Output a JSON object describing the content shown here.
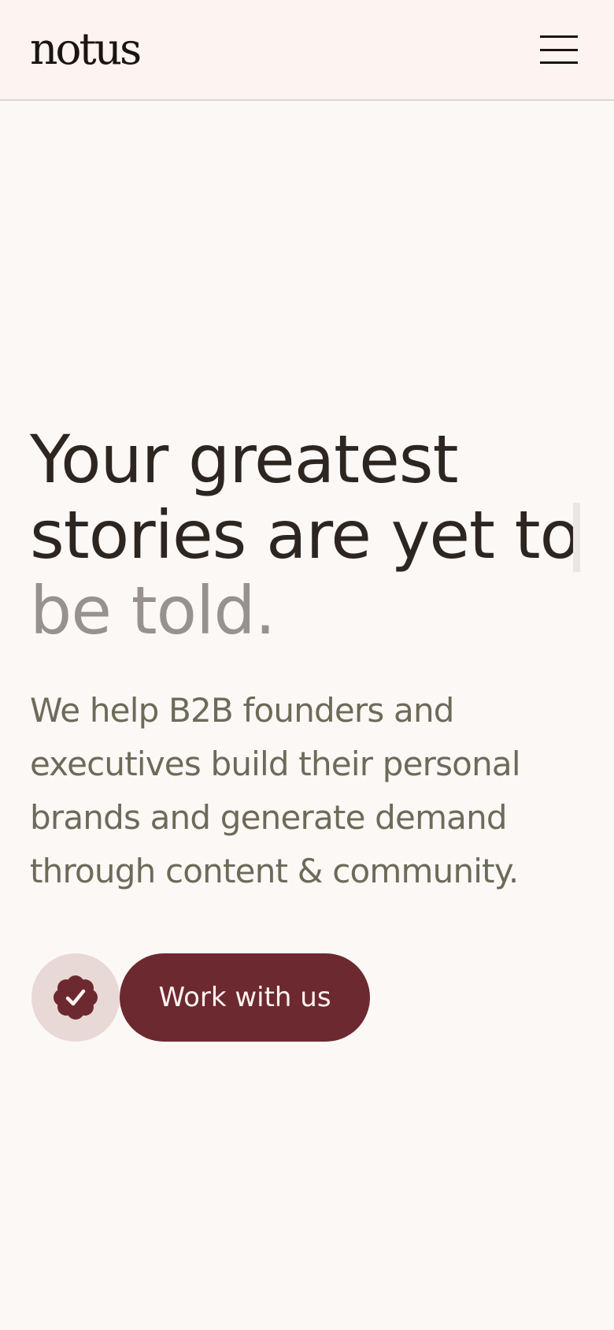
{
  "header": {
    "logo": "notus",
    "menu_icon": "hamburger-menu-icon"
  },
  "hero": {
    "headline_lines": [
      "Your greatest",
      "stories are yet to",
      "be told."
    ],
    "subtext_lines": [
      "We help B2B founders and",
      "executives build their personal",
      "brands and generate demand",
      "through content & community."
    ],
    "badge_icon": "verified-check-icon",
    "cta_label": "Work with us"
  },
  "colors": {
    "header_background": "#fdf3f1",
    "page_background": "#fcf8f5",
    "headline_text": "#2d2520",
    "headline_muted": "#979290",
    "body_text": "#6e6a5a",
    "accent": "#6d2930",
    "badge_background": "#e8d8d6"
  }
}
